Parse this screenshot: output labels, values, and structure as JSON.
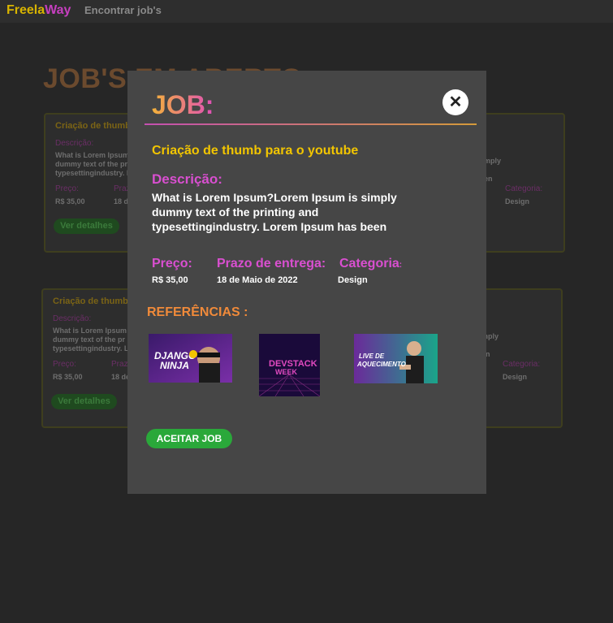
{
  "header": {
    "brand_part1": "Freela",
    "brand_part2": "Way",
    "nav_link": "Encontrar job's"
  },
  "page": {
    "title": "JOB'S EM ABERTO"
  },
  "cards": [
    {
      "title": "Criação de thumb",
      "desc_label": "Descrição:",
      "desc": "What is Lorem Ipsum dummy text of the pr typesettingindustry. L",
      "right_text_1": "mply",
      "right_text_2": "en",
      "price_label": "Preço:",
      "price": "R$ 35,00",
      "prazo_label": "Praz",
      "prazo": "18 de",
      "cat_label": "Categoria:",
      "cat": "Design",
      "button": "Ver detalhes"
    },
    {
      "title": "Criação de thumb",
      "desc_label": "Descrição:",
      "desc": "What is Lorem Ipsum dummy text of the pr typesettingindustry. L",
      "right_text_1": "mply",
      "right_text_2": "en",
      "price_label": "Preço:",
      "price": "R$ 35,00",
      "prazo_label": "Praz",
      "prazo": "18 de",
      "cat_label": "Categoria:",
      "cat": "Design",
      "button": "Ver detalhes"
    }
  ],
  "modal": {
    "title": "JOB:",
    "close_symbol": "✕",
    "job_name": "Criação de thumb para o youtube",
    "desc_label": "Descrição:",
    "desc": "What is Lorem Ipsum?Lorem Ipsum is simply dummy text of the printing and typesettingindustry. Lorem Ipsum has been",
    "price_label": "Preço:",
    "price": "R$ 35,00",
    "prazo_label": "Prazo de entrega:",
    "prazo": "18 de Maio de 2022",
    "cat_label": "Categoria",
    "cat_colon": ":",
    "cat": "Design",
    "refs_label": "REFERÊNCIAS :",
    "accept_button": "ACEITAR JOB",
    "thumbs": [
      {
        "line1": "DJANGO",
        "line2": "NINJA"
      },
      {
        "line1": "DEVSTACK",
        "line2": "WEEK"
      },
      {
        "line1": "LIVE DE",
        "line2": "AQUECIMENTO"
      }
    ]
  },
  "colors": {
    "accent_yellow": "#f2c500",
    "accent_pink": "#d94fd0",
    "accent_orange": "#f08a3a",
    "accept_green": "#2aa83a",
    "modal_bg": "#464646"
  }
}
